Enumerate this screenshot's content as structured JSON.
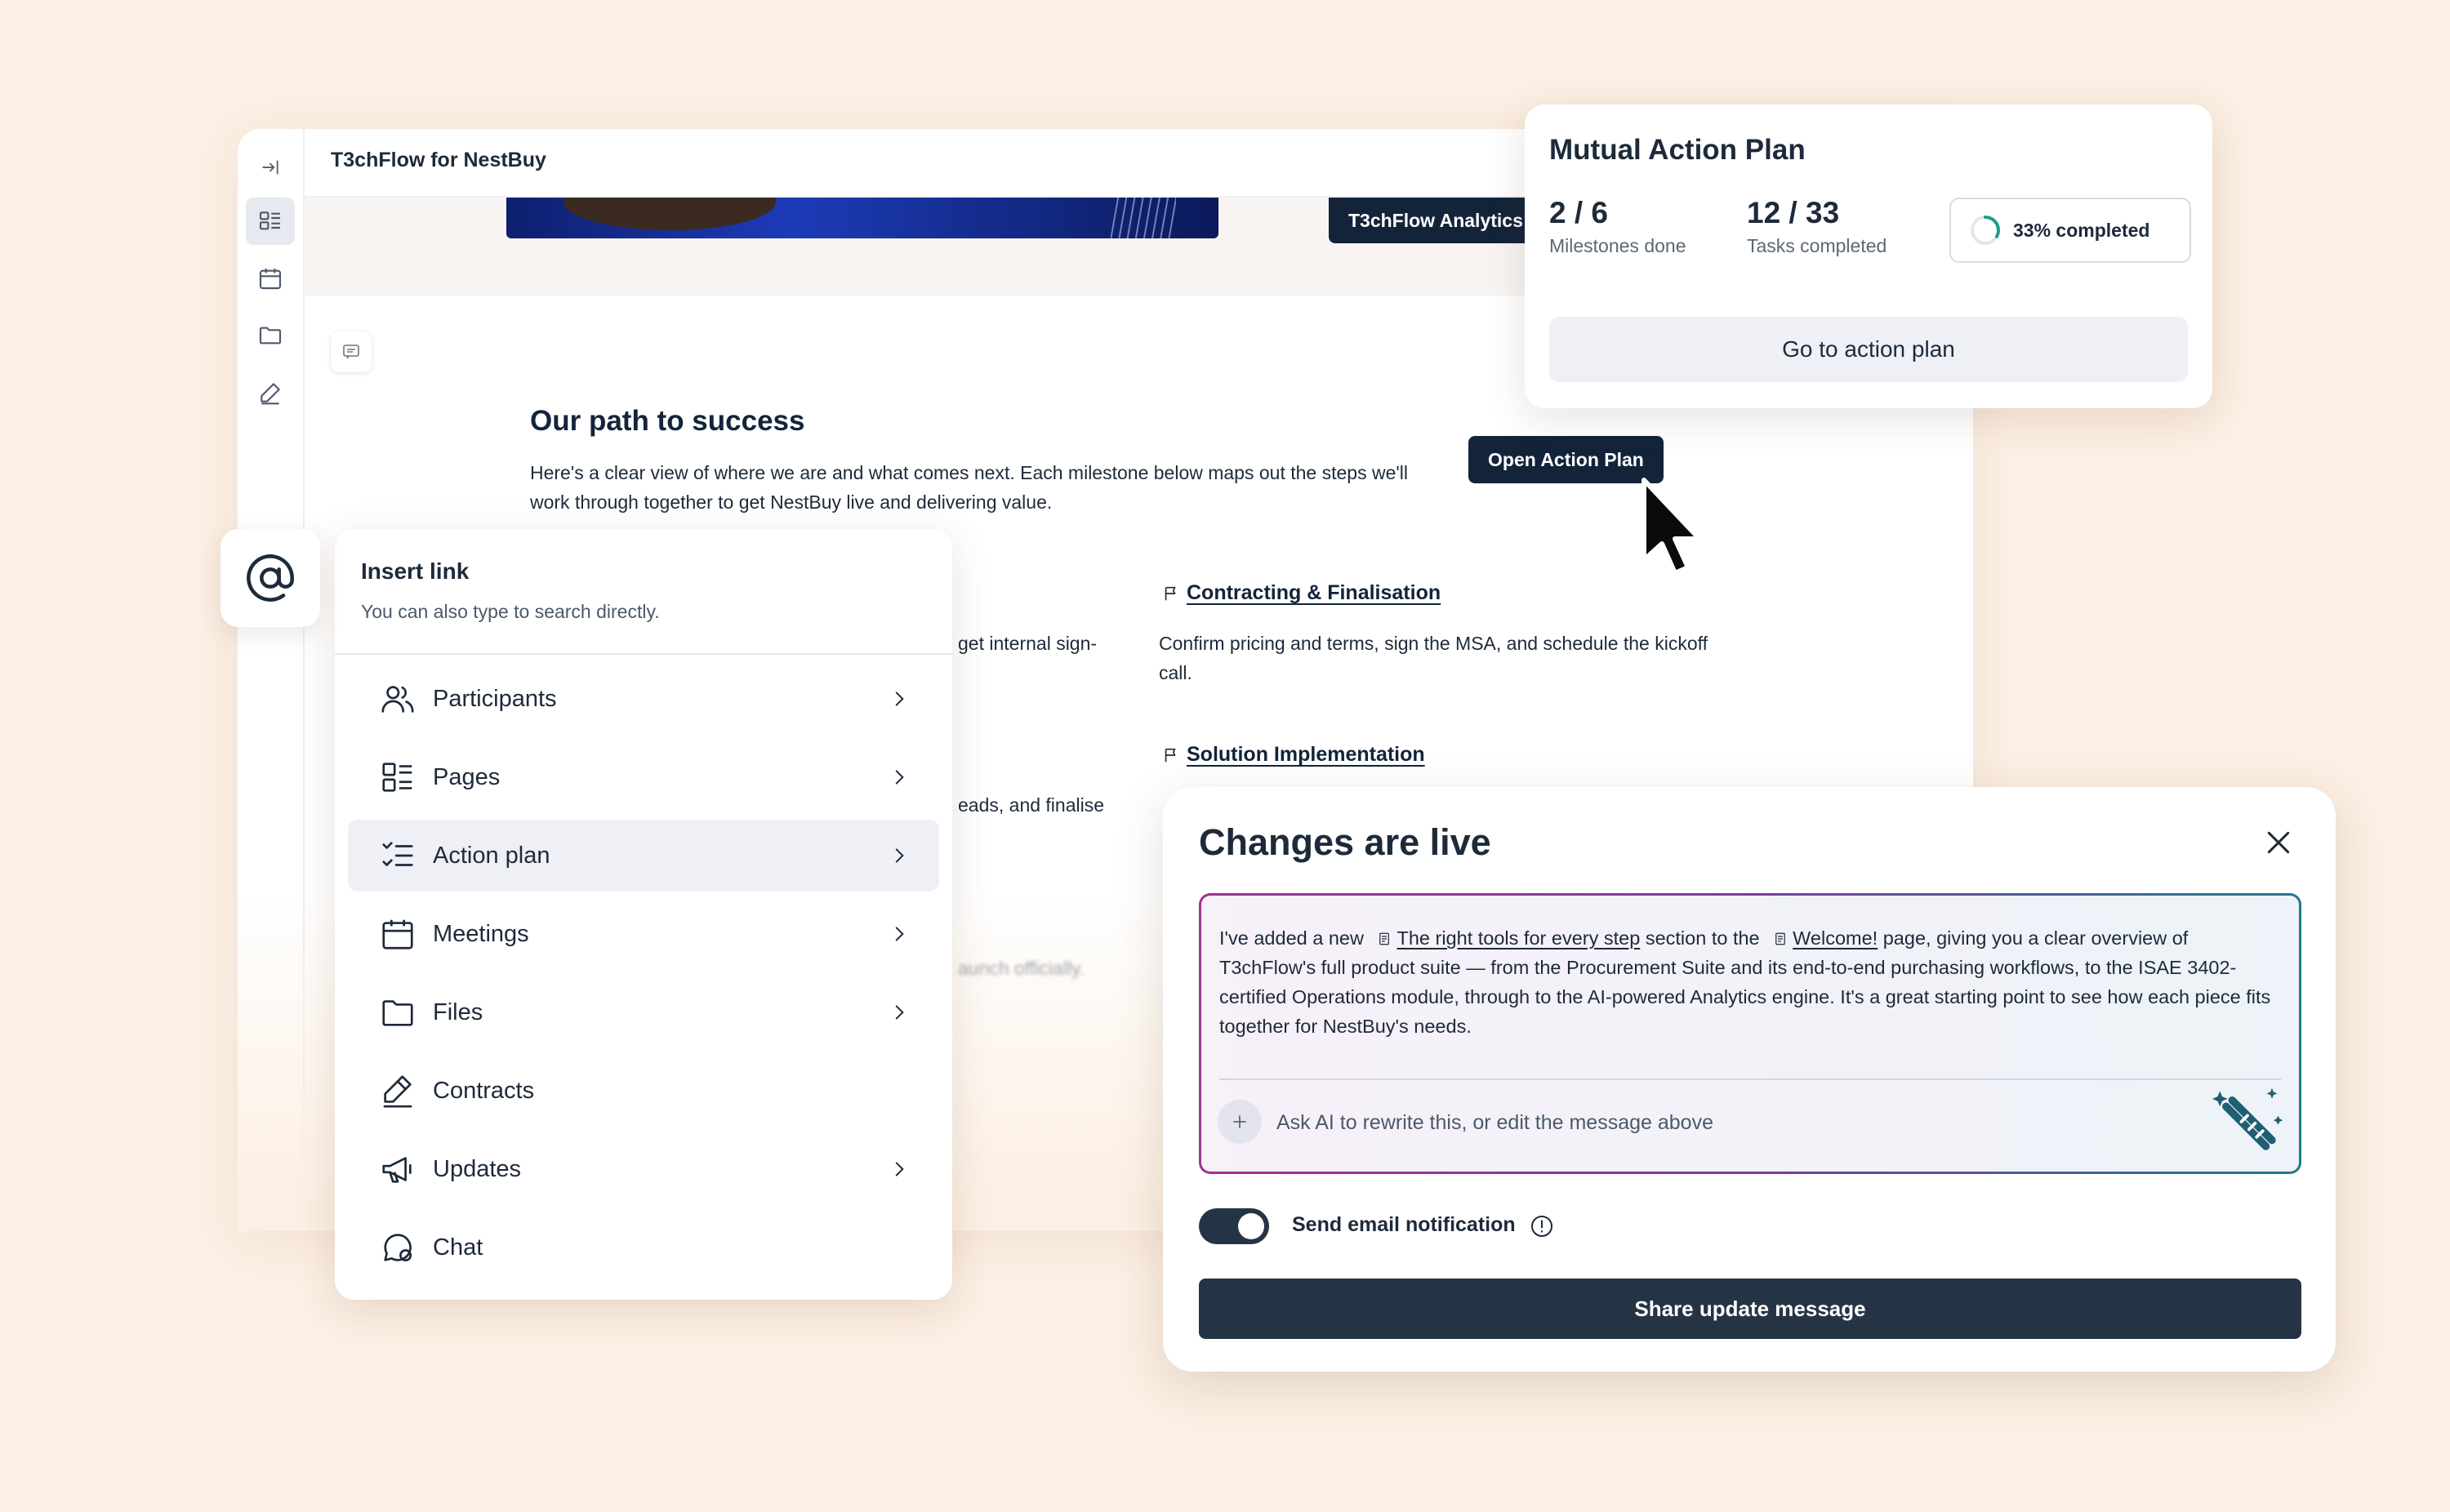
{
  "window": {
    "title": "T3chFlow for NestBuy"
  },
  "hero": {
    "pill_label": "T3chFlow Analytics"
  },
  "section": {
    "title": "Our path to success",
    "description": "Here's a clear view of where we are and what comes next. Each milestone below maps out the steps we'll work through together to get NestBuy live and delivering value.",
    "open_button": "Open Action Plan"
  },
  "milestones": [
    {
      "title": "Contracting & Finalisation",
      "description": "Confirm pricing and terms, sign the MSA, and schedule the kickoff call."
    },
    {
      "title": "Solution Implementation",
      "description": ""
    }
  ],
  "background_fragments": {
    "frag1": "get internal sign-",
    "frag2": "eads, and finalise",
    "frag3": "aunch officially."
  },
  "action_plan_card": {
    "title": "Mutual Action Plan",
    "milestones_value": "2 / 6",
    "milestones_label": "Milestones done",
    "tasks_value": "12 / 33",
    "tasks_label": "Tasks completed",
    "progress_label": "33% completed",
    "progress_fraction": 0.33,
    "button": "Go to action plan"
  },
  "insert_link": {
    "title": "Insert link",
    "subtitle": "You can also type to search directly.",
    "items": [
      {
        "label": "Participants",
        "icon": "participants-icon",
        "chevron": true
      },
      {
        "label": "Pages",
        "icon": "pages-icon",
        "chevron": true
      },
      {
        "label": "Action plan",
        "icon": "action-plan-icon",
        "chevron": true
      },
      {
        "label": "Meetings",
        "icon": "calendar-icon",
        "chevron": true
      },
      {
        "label": "Files",
        "icon": "folder-icon",
        "chevron": true
      },
      {
        "label": "Contracts",
        "icon": "pen-icon",
        "chevron": false
      },
      {
        "label": "Updates",
        "icon": "megaphone-icon",
        "chevron": true
      },
      {
        "label": "Chat",
        "icon": "chat-icon",
        "chevron": false
      }
    ]
  },
  "changes_dialog": {
    "title": "Changes are live",
    "message_part1": "I've added a new",
    "ref1": "The right tools for every step",
    "message_part2": "section to the",
    "ref2": "Welcome!",
    "message_part3": "page, giving you a clear overview of T3chFlow's full product suite — from the Procurement Suite and its end-to-end purchasing workflows, to the ISAE 3402-certified Operations module, through to the AI-powered Analytics engine. It's a great starting point to see how each piece fits together for NestBuy's needs.",
    "ai_placeholder": "Ask AI to rewrite this, or edit the message above",
    "toggle_label": "Send email notification",
    "toggle_on": true,
    "share_button": "Share update message"
  },
  "colors": {
    "background": "#fcefe3",
    "navy": "#13243a",
    "button_dark": "#253445",
    "accent_gradient_start": "#a2318f",
    "accent_gradient_end": "#1f7a8c",
    "progress_ring": "#1aa087"
  }
}
